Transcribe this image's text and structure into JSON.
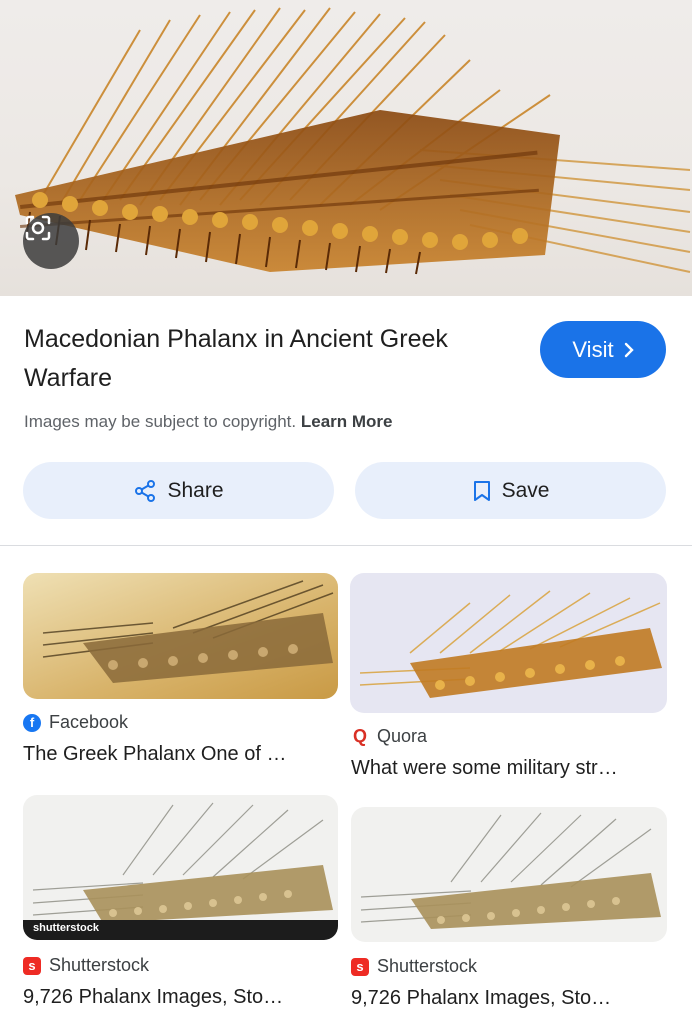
{
  "hero": {
    "lens_label": "Search inside image"
  },
  "result": {
    "title": "Macedonian Phalanx in Ancient Greek Warfare",
    "visit_label": "Visit",
    "copyright_text": "Images may be subject to copyright.",
    "learn_more": "Learn More",
    "share_label": "Share",
    "save_label": "Save"
  },
  "related": [
    {
      "source": "Facebook",
      "title": "The Greek Phalanx One of …"
    },
    {
      "source": "Quora",
      "title": "What were some military str…"
    },
    {
      "source": "Shutterstock",
      "title": "9,726 Phalanx Images, Sto…",
      "watermark": "shutterstock"
    },
    {
      "source": "Shutterstock",
      "title": "9,726 Phalanx Images, Sto…"
    }
  ],
  "colors": {
    "accent": "#1a73e8",
    "button_bg": "#e8effb",
    "facebook": "#1877f2",
    "quora": "#d93025",
    "shutterstock": "#ee2b24"
  }
}
